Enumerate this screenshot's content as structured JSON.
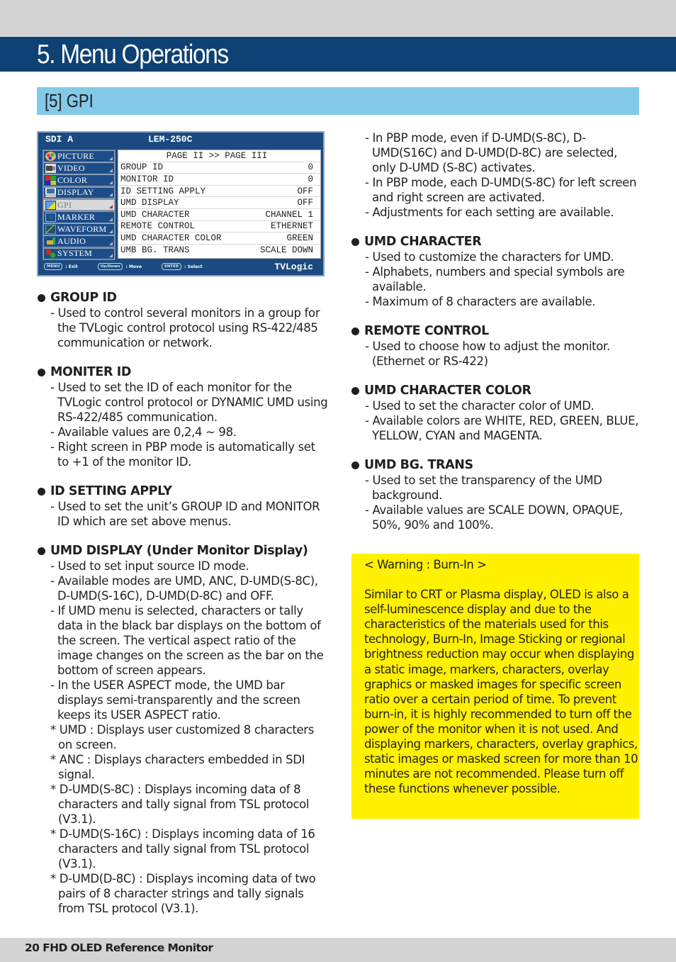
{
  "page": {
    "chapter_title": "5. Menu Operations",
    "section_title": "[5] GPI",
    "footer": "20  FHD OLED Reference Monitor"
  },
  "osd": {
    "source": "SDI A",
    "model": "LEM-250C",
    "brand": "TVLogic",
    "menu_items": [
      {
        "label": "PICTURE",
        "icon": "palette-icon",
        "active": false
      },
      {
        "label": "VIDEO",
        "icon": "camera-icon",
        "active": false
      },
      {
        "label": "COLOR",
        "icon": "color-bars-icon",
        "active": false
      },
      {
        "label": "DISPLAY",
        "icon": "monitor-icon",
        "active": false
      },
      {
        "label": "GPI",
        "icon": "gpi-icon",
        "active": true
      },
      {
        "label": "MARKER",
        "icon": "marker-icon",
        "active": false
      },
      {
        "label": "WAVEFORM",
        "icon": "waveform-icon",
        "active": false
      },
      {
        "label": "AUDIO",
        "icon": "audio-icon",
        "active": false
      },
      {
        "label": "SYSTEM",
        "icon": "gears-icon",
        "active": false
      }
    ],
    "page_header": "PAGE II >> PAGE III",
    "settings": [
      {
        "name": "GROUP ID",
        "value": "0"
      },
      {
        "name": "MONITOR ID",
        "value": "0"
      },
      {
        "name": "ID SETTING APPLY",
        "value": "OFF"
      },
      {
        "name": "UMD DISPLAY",
        "value": "OFF"
      },
      {
        "name": "UMD CHARACTER",
        "value": "CHANNEL 1"
      },
      {
        "name": "REMOTE CONTROL",
        "value": "ETHERNET"
      },
      {
        "name": "UMD CHARACTER COLOR",
        "value": "GREEN"
      },
      {
        "name": "UMB BG. TRANS",
        "value": "SCALE DOWN"
      }
    ],
    "hints": [
      {
        "key": "MENU",
        "action": ": Exit"
      },
      {
        "key": "Up/Down",
        "action": ": Move"
      },
      {
        "key": "ENTER",
        "action": ": Select"
      }
    ]
  },
  "left_column": [
    {
      "title": "GROUP ID",
      "lines": [
        {
          "type": "dash",
          "text": "- Used to control several monitors in a group for the TVLogic control protocol using RS-422/485 communication or network."
        }
      ]
    },
    {
      "title": "MONITER ID",
      "lines": [
        {
          "type": "dash",
          "text": "- Used to set the ID of each monitor for the TVLogic control protocol or DYNAMIC UMD using RS-422/485 communication."
        },
        {
          "type": "dash",
          "text": "- Available values are 0,2,4 ~ 98."
        },
        {
          "type": "dash",
          "text": "- Right screen in PBP mode is automatically set to +1 of the monitor ID."
        }
      ]
    },
    {
      "title": "ID SETTING APPLY",
      "lines": [
        {
          "type": "dash",
          "text": "- Used to set the unit’s GROUP ID and MONITOR ID which are set above menus."
        }
      ]
    },
    {
      "title": "UMD DISPLAY (Under Monitor Display)",
      "lines": [
        {
          "type": "dash",
          "text": "- Used to set input source ID mode."
        },
        {
          "type": "dash",
          "text": "- Available modes are UMD, ANC, D-UMD(S-8C), D-UMD(S-16C), D-UMD(D-8C) and OFF."
        },
        {
          "type": "dash",
          "text": "- If UMD menu is selected, characters or tally data in the black bar displays on the bottom of the screen. The vertical aspect ratio of the image changes on the screen as the bar on the bottom of screen appears."
        },
        {
          "type": "dash",
          "text": "- In the USER ASPECT mode, the UMD bar displays semi-transparently and the screen keeps its USER ASPECT ratio."
        },
        {
          "type": "star",
          "text": "* UMD : Displays user customized 8 characters on screen."
        },
        {
          "type": "star",
          "text": "* ANC : Displays characters embedded in SDI signal."
        },
        {
          "type": "star",
          "text": "* D-UMD(S-8C) : Displays incoming data of 8 characters and tally signal from TSL protocol (V3.1)."
        },
        {
          "type": "star",
          "text": "* D-UMD(S-16C) : Displays incoming data of 16 characters and tally signal from TSL protocol (V3.1)."
        },
        {
          "type": "star",
          "text": "* D-UMD(D-8C) : Displays incoming data of two pairs of 8 character strings and tally signals from TSL protocol (V3.1)."
        }
      ]
    }
  ],
  "right_column": [
    {
      "title": "",
      "lines": [
        {
          "type": "dash",
          "text": "- In PBP mode, even if D-UMD(S-8C), D-UMD(S16C) and D-UMD(D-8C) are selected, only D-UMD (S-8C) activates."
        },
        {
          "type": "dash",
          "text": "- In PBP mode, each D-UMD(S-8C) for left screen and right screen are activated."
        },
        {
          "type": "dash",
          "text": "- Adjustments for each setting are available."
        }
      ]
    },
    {
      "title": "UMD CHARACTER",
      "lines": [
        {
          "type": "dash",
          "text": "- Used to customize the characters for UMD."
        },
        {
          "type": "dash",
          "text": "- Alphabets, numbers and special symbols are available."
        },
        {
          "type": "dash",
          "text": "- Maximum of 8 characters are available."
        }
      ]
    },
    {
      "title": "REMOTE CONTROL",
      "lines": [
        {
          "type": "dash",
          "text": "- Used to choose how to adjust the monitor. (Ethernet or RS-422)"
        }
      ]
    },
    {
      "title": "UMD CHARACTER COLOR",
      "lines": [
        {
          "type": "dash",
          "text": "- Used to set the character color of UMD."
        },
        {
          "type": "dash",
          "text": "- Available colors are WHITE, RED, GREEN, BLUE, YELLOW, CYAN and MAGENTA."
        }
      ]
    },
    {
      "title": "UMD BG. TRANS",
      "lines": [
        {
          "type": "dash",
          "text": "- Used to set the transparency of the UMD background."
        },
        {
          "type": "dash",
          "text": "- Available values are SCALE DOWN, OPAQUE, 50%, 90% and 100%."
        }
      ]
    }
  ],
  "warning": {
    "title": "< Warning : Burn-In >",
    "body": "Similar to CRT or Plasma display, OLED is also a self-luminescence display and due to the characteristics of the materials used for this technology, Burn-In, Image Sticking or regional brightness reduction may occur when displaying a static image, markers, characters, overlay graphics or masked images for specific screen ratio over a certain period of time. To prevent burn-in, it is highly recommended to turn off the power of the monitor when it is not used. And displaying markers, characters, overlay graphics, static images or masked screen for more than 10 minutes are not recommended. Please turn off these functions whenever possible."
  },
  "colors": {
    "title_bar": "#0e4174",
    "section_bar": "#83c9e8",
    "warning_bg": "#fff100",
    "osd_bg": "#1a4a80"
  }
}
